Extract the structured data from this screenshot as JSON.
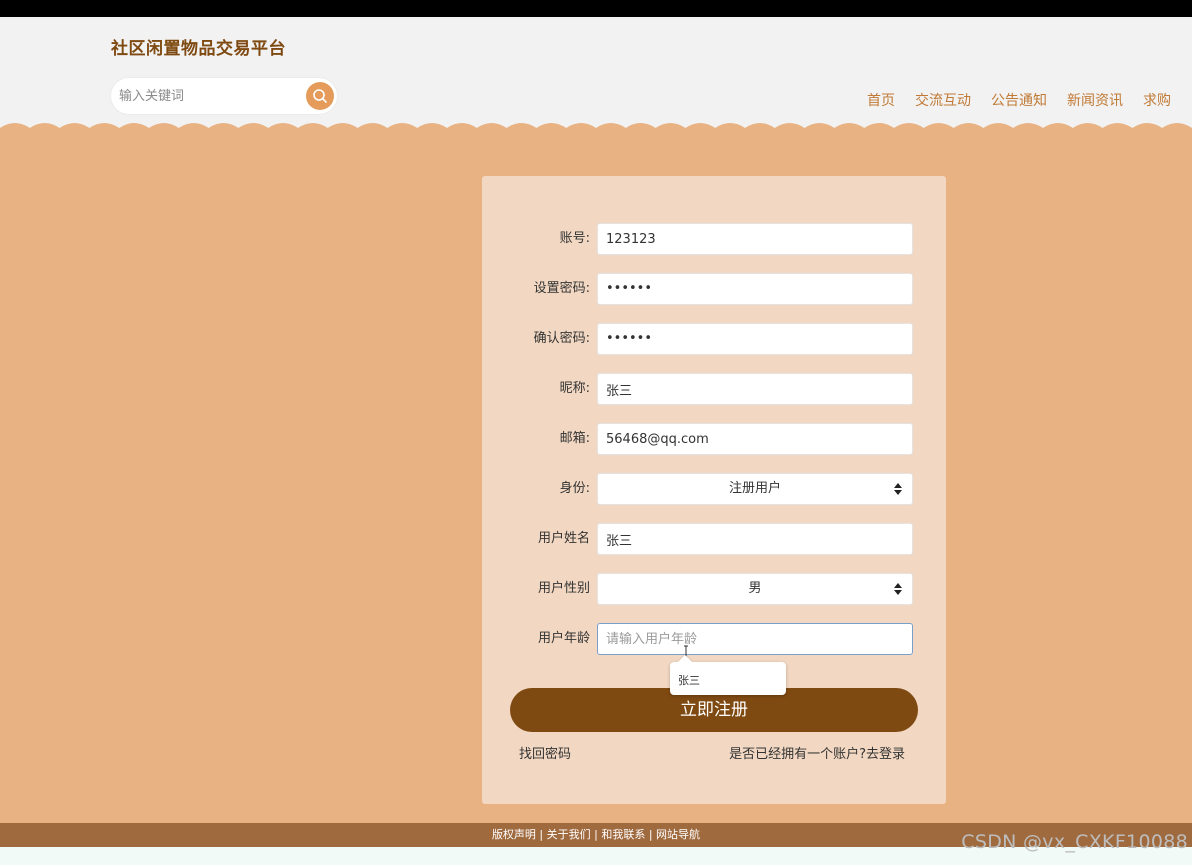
{
  "header": {
    "site_title": "社区闲置物品交易平台",
    "search_placeholder": "输入关键词",
    "nav": [
      "首页",
      "交流互动",
      "公告通知",
      "新闻资讯",
      "求购"
    ]
  },
  "form": {
    "fields": [
      {
        "label": "账号:",
        "value": "123123"
      },
      {
        "label": "设置密码:",
        "value": "••••••"
      },
      {
        "label": "确认密码:",
        "value": "••••••"
      },
      {
        "label": "昵称:",
        "value": "张三"
      },
      {
        "label": "邮箱:",
        "value": "56468@qq.com"
      },
      {
        "label": "身份:",
        "value": "注册用户"
      },
      {
        "label": "用户姓名",
        "value": "张三"
      },
      {
        "label": "用户性别",
        "value": "男"
      },
      {
        "label": "用户年龄",
        "value": "",
        "placeholder": "请输入用户年龄"
      }
    ],
    "autocomplete_suggestion": "张三",
    "submit_label": "立即注册",
    "forgot_link": "找回密码",
    "login_link": "是否已经拥有一个账户?去登录"
  },
  "footer": {
    "text": "版权声明 | 关于我们 | 和我联系 | 网站导航"
  },
  "watermark": "CSDN @vx_CXKF10088",
  "colors": {
    "brand": "#7f4a12",
    "accent": "#e59c5a",
    "main_bg": "#e9b282",
    "card_bg": "#f2d8c2",
    "footer_bg": "#a06a3f"
  }
}
